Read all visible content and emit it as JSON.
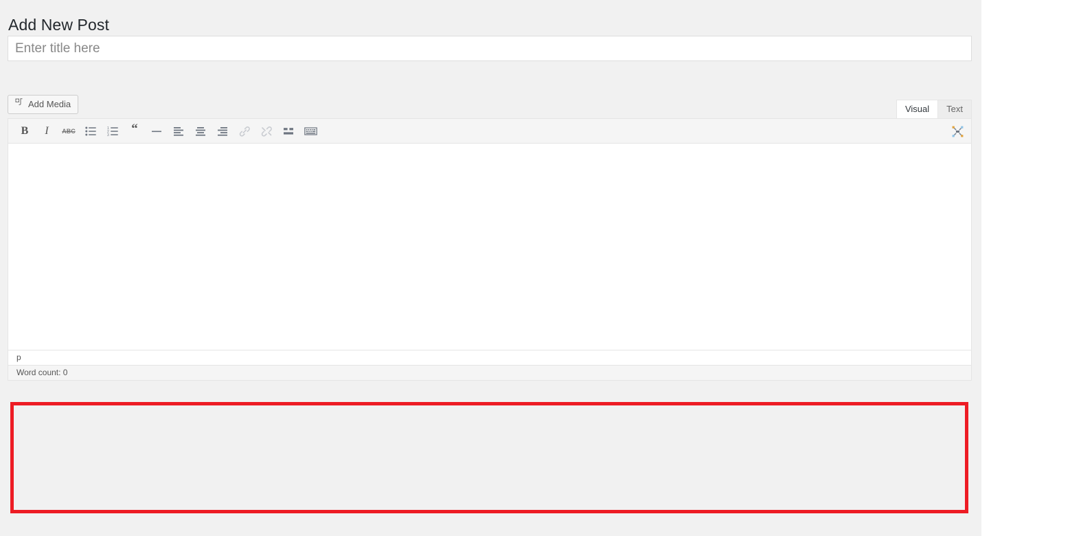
{
  "colors": {
    "page_bg": "#f1f1f1",
    "accent_highlight": "#ed1c24",
    "text_dark": "#23282d",
    "text_muted": "#555555",
    "border": "#e5e5e5",
    "toolbar_bg": "#f5f5f5"
  },
  "header": {
    "title": "Add New Post"
  },
  "title_input": {
    "placeholder": "Enter title here",
    "value": ""
  },
  "media_buttons": [
    {
      "label": "Add Media",
      "icon": "add-media-icon"
    }
  ],
  "editor": {
    "tabs": [
      {
        "label": "Visual",
        "active": true
      },
      {
        "label": "Text",
        "active": false
      }
    ],
    "toolbar": [
      {
        "name": "bold-icon",
        "label": "B",
        "disabled": false
      },
      {
        "name": "italic-icon",
        "label": "I",
        "disabled": false
      },
      {
        "name": "strikethrough-icon",
        "label": "ABC",
        "disabled": false
      },
      {
        "name": "bulleted-list-icon",
        "label": "",
        "disabled": false
      },
      {
        "name": "numbered-list-icon",
        "label": "",
        "disabled": false
      },
      {
        "name": "blockquote-icon",
        "label": "",
        "disabled": false
      },
      {
        "name": "horizontal-rule-icon",
        "label": "",
        "disabled": false
      },
      {
        "name": "align-left-icon",
        "label": "",
        "disabled": false
      },
      {
        "name": "align-center-icon",
        "label": "",
        "disabled": false
      },
      {
        "name": "align-right-icon",
        "label": "",
        "disabled": false
      },
      {
        "name": "insert-link-icon",
        "label": "",
        "disabled": true
      },
      {
        "name": "unlink-icon",
        "label": "",
        "disabled": true
      },
      {
        "name": "insert-more-tag-icon",
        "label": "",
        "disabled": false
      },
      {
        "name": "keyboard-shortcuts-icon",
        "label": "",
        "disabled": false
      }
    ],
    "fullscreen_toggle": {
      "name": "distraction-free-icon"
    },
    "content": "",
    "path": "p",
    "word_count_label": "Word count: 0"
  },
  "highlight": {
    "label": ""
  }
}
